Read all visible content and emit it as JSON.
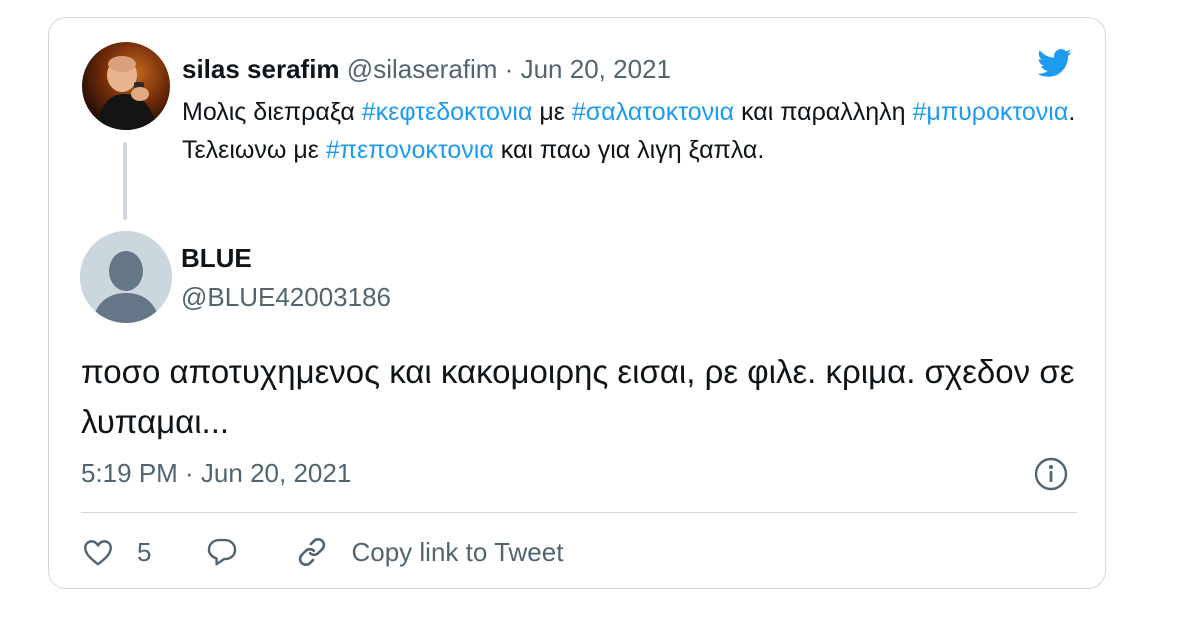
{
  "colors": {
    "accent": "#1d9bf0",
    "muted_text": "#536471",
    "border": "#cfd9de"
  },
  "parent_tweet": {
    "display_name": "silas serafim",
    "handle": "@silaserafim",
    "separator": "·",
    "date": "Jun 20, 2021",
    "text_segments": [
      {
        "text": "Μολις διεπραξα ",
        "hashtag": false
      },
      {
        "text": "#κεφτεδοκτονια",
        "hashtag": true
      },
      {
        "text": " με ",
        "hashtag": false
      },
      {
        "text": "#σαλατοκτονια",
        "hashtag": true
      },
      {
        "text": " και παραλληλη ",
        "hashtag": false
      },
      {
        "text": "#μπυροκτονια",
        "hashtag": true
      },
      {
        "text": ". Τελειωνω με ",
        "hashtag": false
      },
      {
        "text": "#πεπονοκτονια",
        "hashtag": true
      },
      {
        "text": " και παω για λιγη ξαπλα.",
        "hashtag": false
      }
    ]
  },
  "reply_tweet": {
    "display_name": "BLUE",
    "handle": "@BLUE42003186",
    "text": "ποσο αποτυχημενος και κακομοιρης εισαι, ρε φιλε. κριμα. σχεδον σε λυπαμαι...",
    "timestamp": "5:19 PM · Jun 20, 2021"
  },
  "actions": {
    "like_count": "5",
    "copy_link_label": "Copy link to Tweet"
  },
  "icons": {
    "brand": "twitter-bird-icon",
    "info": "info-icon",
    "like": "heart-icon",
    "reply": "reply-bubble-icon",
    "copy": "link-icon"
  }
}
